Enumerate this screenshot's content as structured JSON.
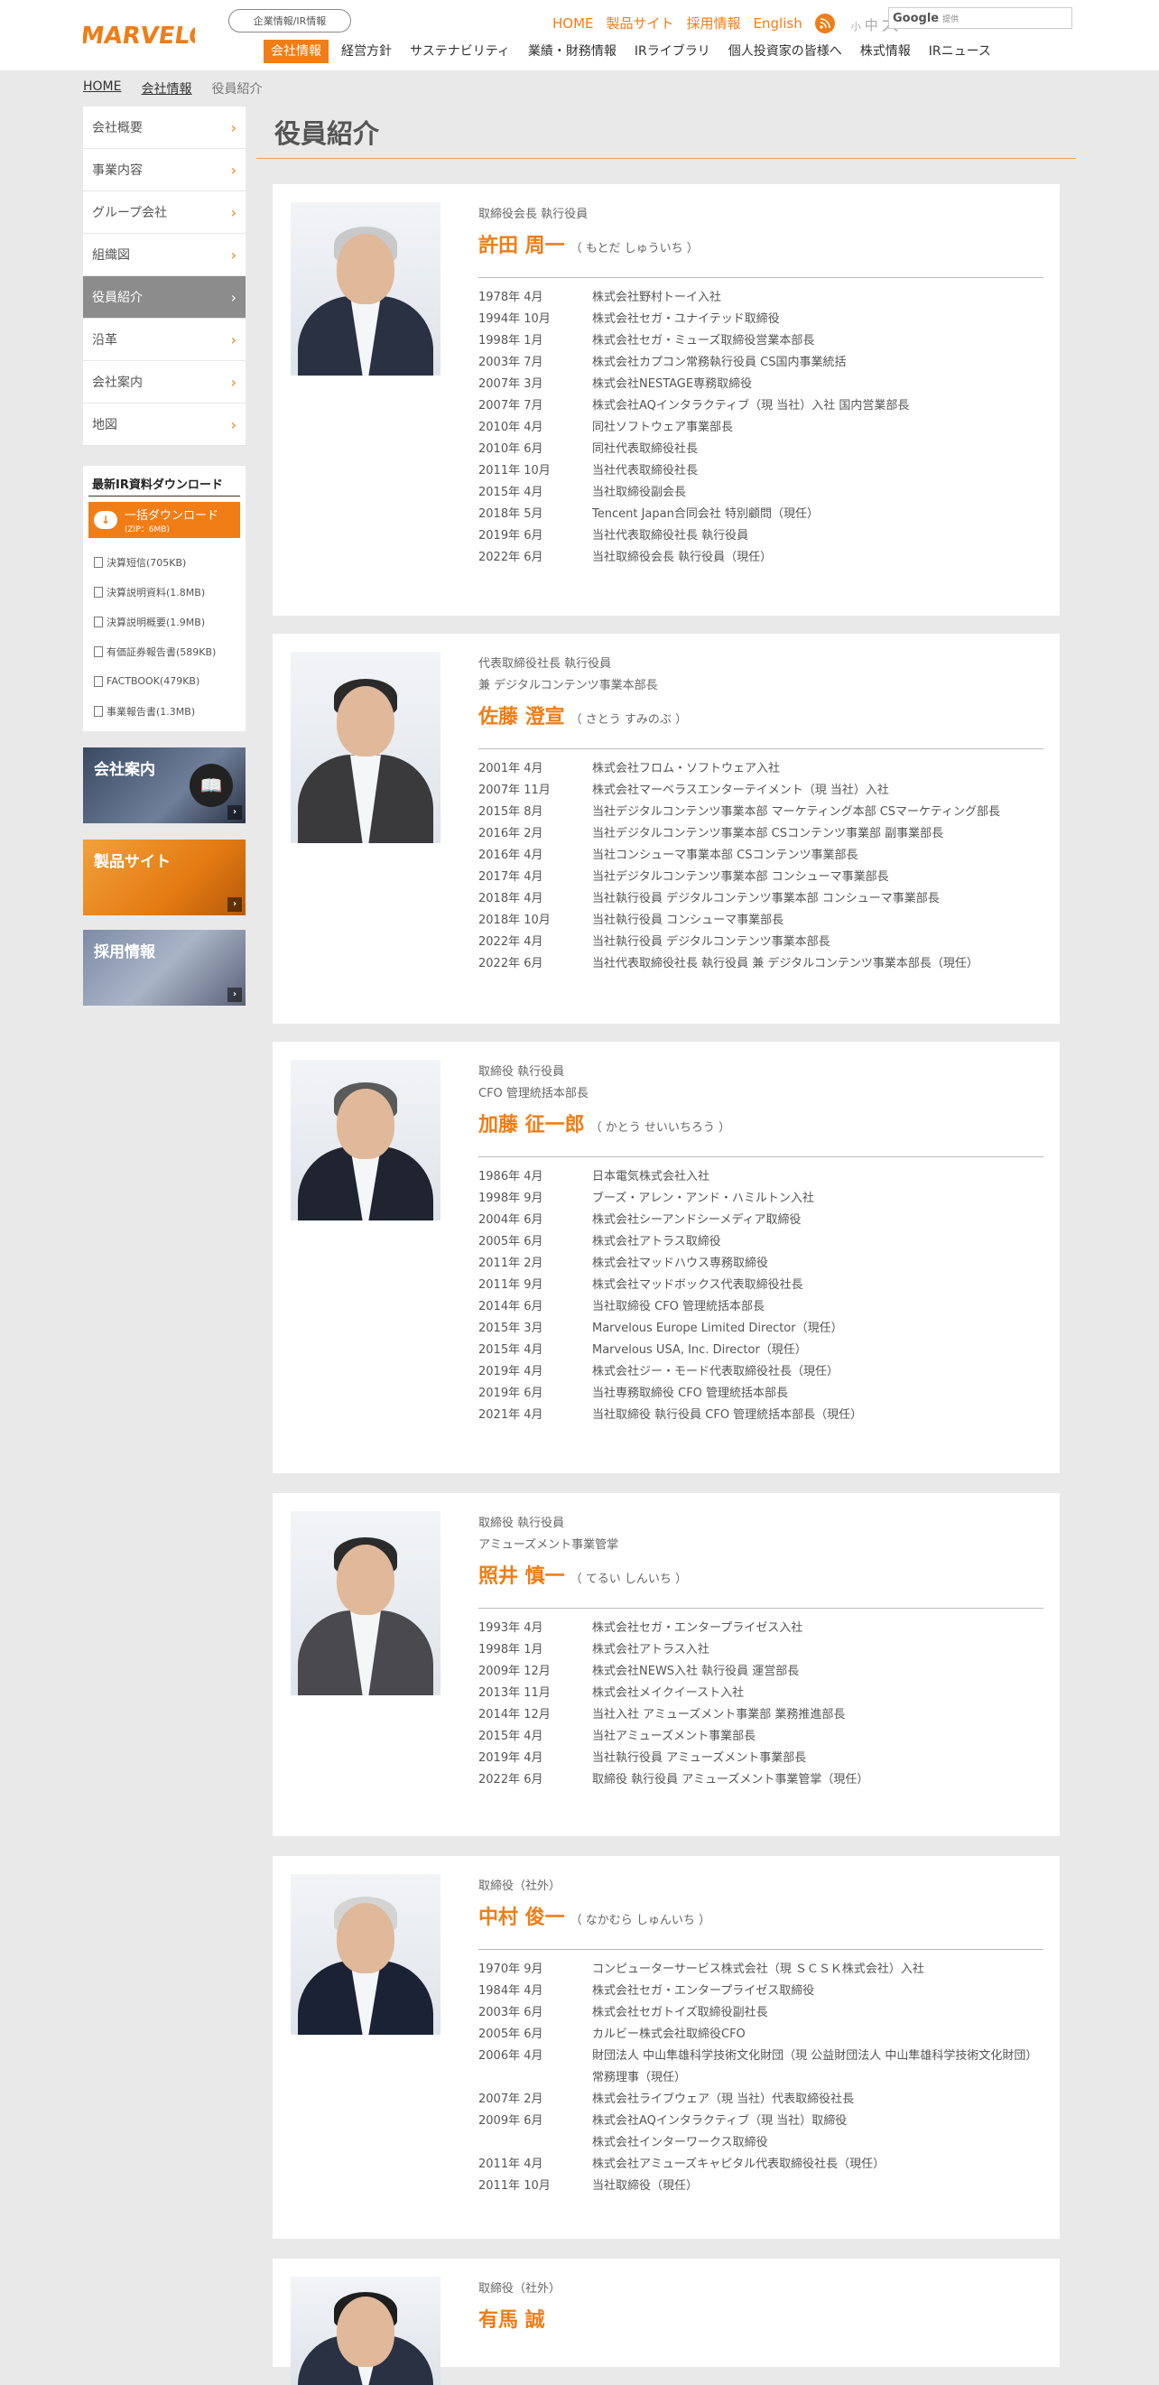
{
  "header": {
    "logo_text": "MARVELOUS!",
    "corp_button": "企業情報/IR情報",
    "links": [
      "HOME",
      "製品サイト",
      "採用情報",
      "English"
    ],
    "fontsize": [
      "小",
      "中",
      "大"
    ],
    "search_brand": "Google",
    "search_sub": "提供",
    "nav": [
      "会社情報",
      "経営方針",
      "サステナビリティ",
      "業績・財務情報",
      "IRライブラリ",
      "個人投資家の皆様へ",
      "株式情報",
      "IRニュース"
    ]
  },
  "breadcrumb": [
    "HOME",
    "会社情報",
    "役員紹介"
  ],
  "sidebar": {
    "menu": [
      "会社概要",
      "事業内容",
      "グループ会社",
      "組織図",
      "役員紹介",
      "沿革",
      "会社案内",
      "地図"
    ],
    "ir_title": "最新IR資料ダウンロード",
    "dl_label": "一括ダウンロード",
    "dl_sub": "(ZIP：6MB)",
    "files": [
      "決算短信(705KB)",
      "決算説明資料(1.8MB)",
      "決算説明概要(1.9MB)",
      "有価証券報告書(589KB)",
      "FACTBOOK(479KB)",
      "事業報告書(1.3MB)"
    ],
    "banners": [
      "会社案内",
      "製品サイト",
      "採用情報"
    ]
  },
  "page_title": "役員紹介",
  "officers": [
    {
      "roles": [
        "取締役会長 執行役員"
      ],
      "name": "許田 周一",
      "kana": "（ もとだ しゅういち ）",
      "history": [
        [
          "1978年 4月",
          "株式会社野村トーイ入社"
        ],
        [
          "1994年 10月",
          "株式会社セガ・ユナイテッド取締役"
        ],
        [
          "1998年 1月",
          "株式会社セガ・ミューズ取締役営業本部長"
        ],
        [
          "2003年 7月",
          "株式会社カプコン常務執行役員 CS国内事業統括"
        ],
        [
          "2007年 3月",
          "株式会社NESTAGE専務取締役"
        ],
        [
          "2007年 7月",
          "株式会社AQインタラクティブ（現 当社）入社 国内営業部長"
        ],
        [
          "2010年 4月",
          "同社ソフトウェア事業部長"
        ],
        [
          "2010年 6月",
          "同社代表取締役社長"
        ],
        [
          "2011年 10月",
          "当社代表取締役社長"
        ],
        [
          "2015年 4月",
          "当社取締役副会長"
        ],
        [
          "2018年 5月",
          "Tencent Japan合同会社 特別顧問（現任）"
        ],
        [
          "2019年 6月",
          "当社代表取締役社長 執行役員"
        ],
        [
          "2022年 6月",
          "当社取締役会長 執行役員（現任）"
        ]
      ]
    },
    {
      "roles": [
        "代表取締役社長 執行役員",
        "兼 デジタルコンテンツ事業本部長"
      ],
      "name": "佐藤 澄宣",
      "kana": "（ さとう すみのぶ ）",
      "history": [
        [
          "2001年 4月",
          "株式会社フロム・ソフトウェア入社"
        ],
        [
          "2007年 11月",
          "株式会社マーベラスエンターテイメント（現 当社）入社"
        ],
        [
          "2015年 8月",
          "当社デジタルコンテンツ事業本部 マーケティング本部 CSマーケティング部長"
        ],
        [
          "2016年 2月",
          "当社デジタルコンテンツ事業本部 CSコンテンツ事業部 副事業部長"
        ],
        [
          "2016年 4月",
          "当社コンシューマ事業本部 CSコンテンツ事業部長"
        ],
        [
          "2017年 4月",
          "当社デジタルコンテンツ事業本部 コンシューマ事業部長"
        ],
        [
          "2018年 4月",
          "当社執行役員 デジタルコンテンツ事業本部 コンシューマ事業部長"
        ],
        [
          "2018年 10月",
          "当社執行役員 コンシューマ事業部長"
        ],
        [
          "2022年 4月",
          "当社執行役員 デジタルコンテンツ事業本部長"
        ],
        [
          "2022年 6月",
          "当社代表取締役社長 執行役員 兼 デジタルコンテンツ事業本部長（現任）"
        ]
      ]
    },
    {
      "roles": [
        "取締役 執行役員",
        "CFO 管理統括本部長"
      ],
      "name": "加藤 征一郎",
      "kana": "（ かとう せいいちろう ）",
      "history": [
        [
          "1986年 4月",
          "日本電気株式会社入社"
        ],
        [
          "1998年 9月",
          "ブーズ・アレン・アンド・ハミルトン入社"
        ],
        [
          "2004年 6月",
          "株式会社シーアンドシーメディア取締役"
        ],
        [
          "2005年 6月",
          "株式会社アトラス取締役"
        ],
        [
          "2011年 2月",
          "株式会社マッドハウス専務取締役"
        ],
        [
          "2011年 9月",
          "株式会社マッドボックス代表取締役社長"
        ],
        [
          "2014年 6月",
          "当社取締役 CFO 管理統括本部長"
        ],
        [
          "2015年 3月",
          "Marvelous Europe Limited Director（現任）"
        ],
        [
          "2015年 4月",
          "Marvelous USA, Inc. Director（現任）"
        ],
        [
          "2019年 4月",
          "株式会社ジー・モード代表取締役社長（現任）"
        ],
        [
          "2019年 6月",
          "当社専務取締役 CFO 管理統括本部長"
        ],
        [
          "2021年 4月",
          "当社取締役 執行役員 CFO 管理統括本部長（現任）"
        ]
      ]
    },
    {
      "roles": [
        "取締役 執行役員",
        "アミューズメント事業管掌"
      ],
      "name": "照井 慎一",
      "kana": "（ てるい しんいち ）",
      "history": [
        [
          "1993年 4月",
          "株式会社セガ・エンタープライゼス入社"
        ],
        [
          "1998年 1月",
          "株式会社アトラス入社"
        ],
        [
          "2009年 12月",
          "株式会社NEWS入社 執行役員 運営部長"
        ],
        [
          "2013年 11月",
          "株式会社メイクイースト入社"
        ],
        [
          "2014年 12月",
          "当社入社 アミューズメント事業部 業務推進部長"
        ],
        [
          "2015年 4月",
          "当社アミューズメント事業部長"
        ],
        [
          "2019年 4月",
          "当社執行役員 アミューズメント事業部長"
        ],
        [
          "2022年 6月",
          "取締役 執行役員 アミューズメント事業管掌（現任）"
        ]
      ]
    },
    {
      "roles": [
        "取締役（社外）"
      ],
      "name": "中村 俊一",
      "kana": "（ なかむら しゅんいち ）",
      "history": [
        [
          "1970年 9月",
          "コンピューターサービス株式会社（現 ＳＣＳＫ株式会社）入社"
        ],
        [
          "1984年 4月",
          "株式会社セガ・エンタープライゼス取締役"
        ],
        [
          "2003年 6月",
          "株式会社セガトイズ取締役副社長"
        ],
        [
          "2005年 6月",
          "カルビー株式会社取締役CFO"
        ],
        [
          "2006年 4月",
          "財団法人 中山隼雄科学技術文化財団（現 公益財団法人 中山隼雄科学技術文化財団）常務理事（現任）"
        ],
        [
          "2007年 2月",
          "株式会社ライブウェア（現 当社）代表取締役社長"
        ],
        [
          "2009年 6月",
          "株式会社AQインタラクティブ（現 当社）取締役"
        ],
        [
          "",
          "株式会社インターワークス取締役"
        ],
        [
          "2011年 4月",
          "株式会社アミューズキャピタル代表取締役社長（現任）"
        ],
        [
          "2011年 10月",
          "当社取締役（現任）"
        ]
      ]
    },
    {
      "roles": [
        "取締役（社外）"
      ],
      "name": "有馬 誠",
      "kana": "",
      "history": []
    }
  ]
}
